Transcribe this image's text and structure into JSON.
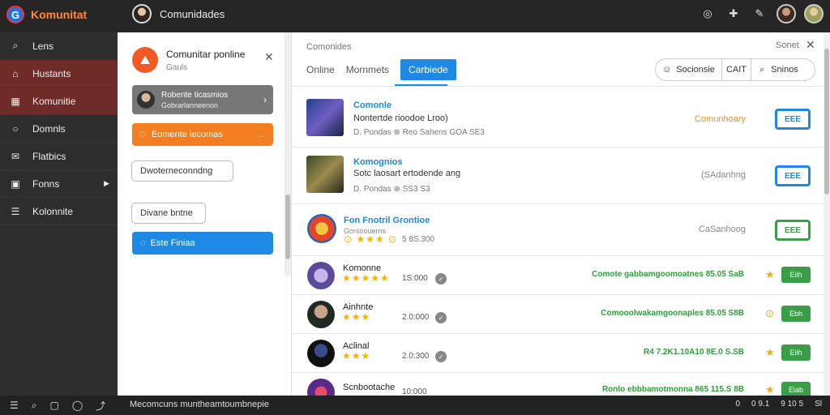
{
  "topbar": {
    "brand_logo": "G",
    "brand_name": "Komunitat",
    "title": "Comunidades",
    "icons": [
      "messenger-icon",
      "puzzle-icon",
      "wrench-icon"
    ]
  },
  "sidebar": {
    "items": [
      {
        "label": "Lens",
        "icon": "search-icon"
      },
      {
        "label": "Hustants",
        "icon": "home-icon"
      },
      {
        "label": "Komunitie",
        "icon": "grid-icon"
      },
      {
        "label": "Domnls",
        "icon": "circle-icon"
      },
      {
        "label": "Flatbics",
        "icon": "mail-icon"
      },
      {
        "label": "Fonns",
        "icon": "image-icon"
      },
      {
        "label": "Kolonnite",
        "icon": "list-icon"
      }
    ]
  },
  "panel": {
    "title": "Comunitar ponline",
    "subtitle": "Gauls",
    "card_title": "Robente ticasmios",
    "card_sub": "Gobrarlanneenon",
    "orange_label": "Eomente lecomas",
    "orange_dots": "...",
    "outline1": "Dwoterneconndng",
    "outline2": "Divane bntne",
    "blue_label": "Este Finiaa"
  },
  "main": {
    "title": "Comonides",
    "close_label": "Sonet",
    "tabs": [
      "Online",
      "Mornmets",
      "Carbiede"
    ],
    "search_left": "Socionsie",
    "search_mid": "CAIT",
    "search_right": "Sninos"
  },
  "rows": [
    {
      "name": "Comonle",
      "desc": "Nontertde rioodoe Lroo)",
      "meta": "D. Pondas  ⊗  Reo Sahens  GOA  SE3",
      "category": "Comunhoary",
      "button": "EEE",
      "cat_color": "#e8912b",
      "btn_color": "#1e88e5"
    },
    {
      "name": "Komognios",
      "desc": "Sotc laosart ertodende ang",
      "meta": "D. Pondas  ⊗  SS3 S3",
      "category": "(SAdanhng",
      "button": "EEE",
      "cat_color": "#888888",
      "btn_color": "#1e88e5"
    },
    {
      "name": "Fon Fnotril Grontioe",
      "desc": "Gorsoouerns",
      "meta": "5 8S.300",
      "category": "CaSanhoog",
      "button": "EEE",
      "cat_color": "#888888",
      "btn_color": "#3a9e48"
    }
  ],
  "community_rows": [
    {
      "name": "Komonne",
      "rating": "★★★★★",
      "count": "1S:000",
      "green": "Comote gabbamgoomoatnes 85.05 SaB",
      "star": "★",
      "button": "Eilh"
    },
    {
      "name": "Ainhnte",
      "rating": "★★★",
      "count": "2.0:000",
      "green": "Comooolwakamgoonaples 85.05 S8B",
      "star": "⊙",
      "button": "Ebh"
    },
    {
      "name": "Aclinal",
      "rating": "★★★",
      "count": "2.0:300",
      "green": "R4 7.2K1.10A10 8E.0 S.SB",
      "star": "★",
      "button": "Eilh"
    },
    {
      "name": "Scnbootache",
      "rating": "★★★",
      "count": "10:000",
      "green": "Ronlo ebbbamotmonna 865 115.S 8B",
      "star": "★",
      "button": "Eiab"
    }
  ],
  "bottombar": {
    "text": "Mecomcuns muntheamtoumbnepie",
    "right": [
      "0",
      "0 9.1",
      "9 10 5",
      "Sl"
    ]
  }
}
